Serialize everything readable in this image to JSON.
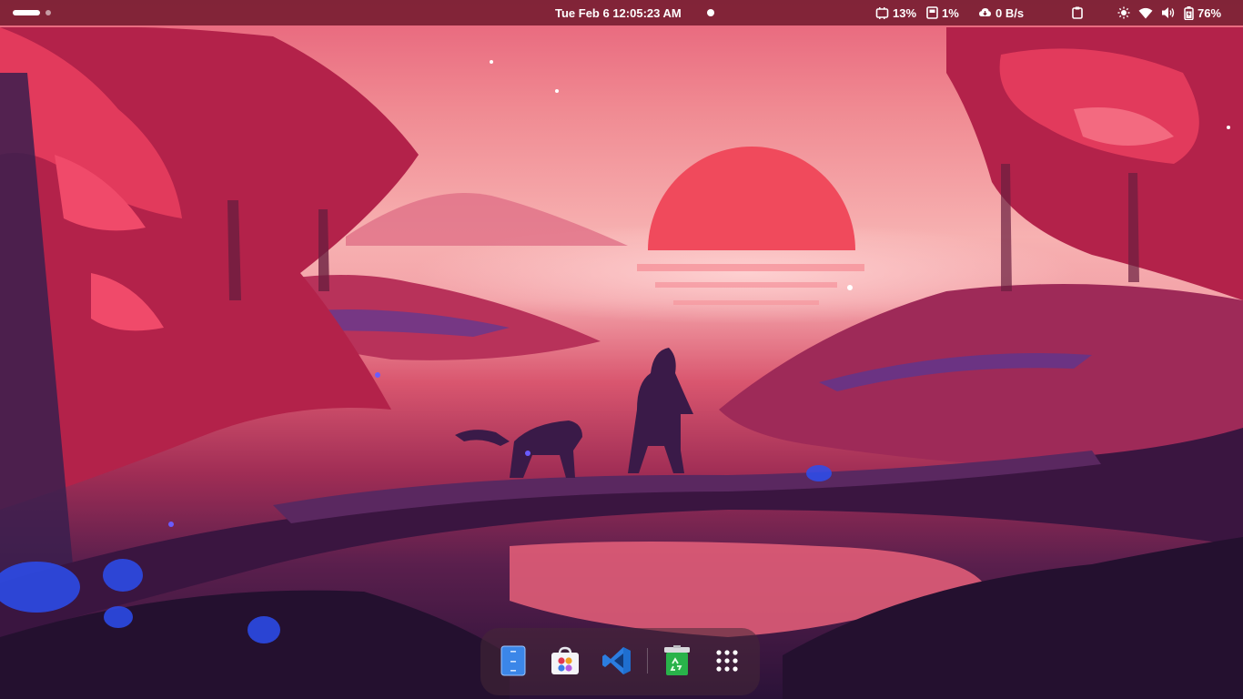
{
  "topbar": {
    "clock": "Tue Feb 6  12:05:23 AM",
    "cpu": "13%",
    "memory": "1%",
    "network": "0 B/s",
    "battery": "76%"
  },
  "dock": {
    "apps": [
      {
        "icon": "file-manager-icon"
      },
      {
        "icon": "software-store-icon"
      },
      {
        "icon": "vscode-icon"
      },
      {
        "icon": "trash-icon"
      },
      {
        "icon": "app-grid-icon"
      }
    ]
  },
  "colors": {
    "topbar": "#781e32",
    "sun": "#f04a5c",
    "accent_blue": "#2b7de0"
  }
}
